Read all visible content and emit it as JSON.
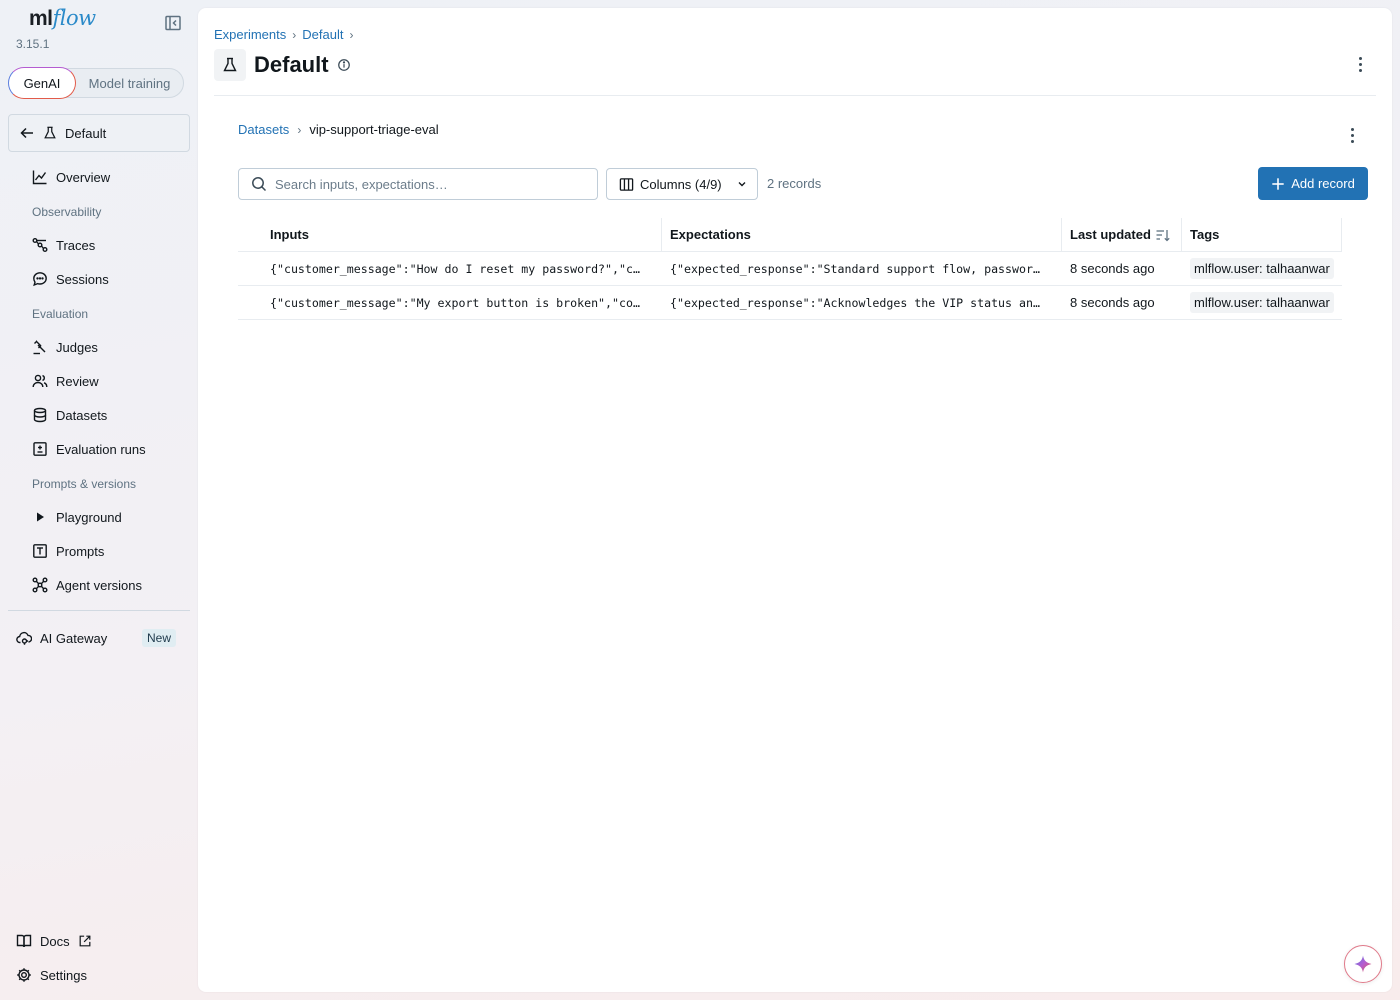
{
  "app": {
    "logo_prefix": "ml",
    "logo_suffix": "flow",
    "version": "3.15.1"
  },
  "mode_toggle": {
    "genai": "GenAI",
    "training": "Model training"
  },
  "sidebar": {
    "experiment": "Default",
    "overview": "Overview",
    "observability_section": "Observability",
    "traces": "Traces",
    "sessions": "Sessions",
    "evaluation_section": "Evaluation",
    "judges": "Judges",
    "review": "Review",
    "datasets": "Datasets",
    "evaluation_runs": "Evaluation runs",
    "prompts_section": "Prompts & versions",
    "playground": "Playground",
    "prompts": "Prompts",
    "agent_versions": "Agent versions",
    "ai_gateway": "AI Gateway",
    "new_badge": "New",
    "docs": "Docs",
    "settings": "Settings"
  },
  "header": {
    "breadcrumb": [
      "Experiments",
      "Default"
    ],
    "title": "Default"
  },
  "dataset": {
    "breadcrumb_root": "Datasets",
    "name": "vip-support-triage-eval",
    "search_placeholder": "Search inputs, expectations…",
    "columns_label": "Columns (4/9)",
    "records_count": "2 records",
    "add_label": "Add record"
  },
  "table": {
    "headers": [
      "Inputs",
      "Expectations",
      "Last updated",
      "Tags"
    ],
    "rows": [
      {
        "inputs": "{\"customer_message\":\"How do I reset my password?\",\"c…",
        "expectations": "{\"expected_response\":\"Standard support flow, passwor…",
        "updated": "8 seconds ago",
        "tag": "mlflow.user: talhaanwar"
      },
      {
        "inputs": "{\"customer_message\":\"My export button is broken\",\"co…",
        "expectations": "{\"expected_response\":\"Acknowledges the VIP status an…",
        "updated": "8 seconds ago",
        "tag": "mlflow.user: talhaanwar"
      }
    ]
  }
}
